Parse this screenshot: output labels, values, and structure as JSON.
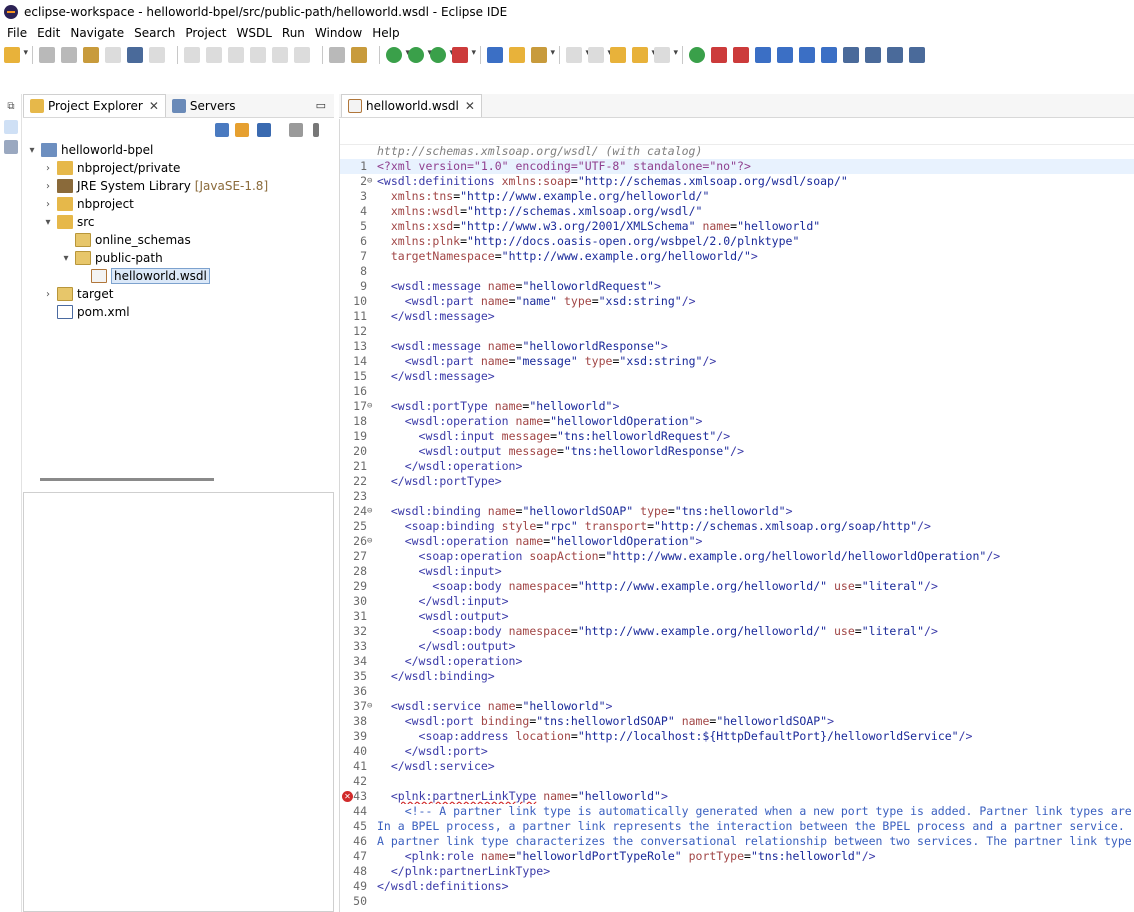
{
  "window": {
    "title": "eclipse-workspace - helloworld-bpel/src/public-path/helloworld.wsdl - Eclipse IDE"
  },
  "menu": [
    "File",
    "Edit",
    "Navigate",
    "Search",
    "Project",
    "WSDL",
    "Run",
    "Window",
    "Help"
  ],
  "explorer": {
    "tabs": [
      {
        "label": "Project Explorer",
        "active": true
      },
      {
        "label": "Servers",
        "active": false
      }
    ],
    "tree": [
      {
        "label": "helloworld-bpel",
        "depth": 0,
        "expanded": true,
        "icon": "project-icon"
      },
      {
        "label": "nbproject/private",
        "depth": 1,
        "expanded": false,
        "icon": "package-folder-icon"
      },
      {
        "label": "JRE System Library",
        "decoration": "[JavaSE-1.8]",
        "depth": 1,
        "expanded": false,
        "icon": "library-icon"
      },
      {
        "label": "nbproject",
        "depth": 1,
        "expanded": false,
        "icon": "package-folder-icon"
      },
      {
        "label": "src",
        "depth": 1,
        "expanded": true,
        "icon": "package-folder-icon"
      },
      {
        "label": "online_schemas",
        "depth": 2,
        "expanded": null,
        "icon": "folder-icon"
      },
      {
        "label": "public-path",
        "depth": 2,
        "expanded": true,
        "icon": "folder-icon"
      },
      {
        "label": "helloworld.wsdl",
        "depth": 3,
        "expanded": null,
        "icon": "wsdl-file-icon",
        "selected": true
      },
      {
        "label": "target",
        "depth": 1,
        "expanded": false,
        "icon": "folder-icon"
      },
      {
        "label": "pom.xml",
        "depth": 1,
        "expanded": null,
        "icon": "maven-file-icon"
      }
    ]
  },
  "editor": {
    "tab": "helloworld.wsdl",
    "schema_hint": "http://schemas.xmlsoap.org/wsdl/ (with catalog)",
    "lines": [
      {
        "n": "1",
        "text": "<?xml version=\"1.0\" encoding=\"UTF-8\" standalone=\"no\"?>"
      },
      {
        "n": "2",
        "text": "<wsdl:definitions xmlns:soap=\"http://schemas.xmlsoap.org/wsdl/soap/\""
      },
      {
        "n": "3",
        "text": "  xmlns:tns=\"http://www.example.org/helloworld/\""
      },
      {
        "n": "4",
        "text": "  xmlns:wsdl=\"http://schemas.xmlsoap.org/wsdl/\""
      },
      {
        "n": "5",
        "text": "  xmlns:xsd=\"http://www.w3.org/2001/XMLSchema\" name=\"helloworld\""
      },
      {
        "n": "6",
        "text": "  xmlns:plnk=\"http://docs.oasis-open.org/wsbpel/2.0/plnktype\""
      },
      {
        "n": "7",
        "text": "  targetNamespace=\"http://www.example.org/helloworld/\">"
      },
      {
        "n": "8",
        "text": ""
      },
      {
        "n": "9",
        "text": "  <wsdl:message name=\"helloworldRequest\">"
      },
      {
        "n": "10",
        "text": "    <wsdl:part name=\"name\" type=\"xsd:string\"/>"
      },
      {
        "n": "11",
        "text": "  </wsdl:message>"
      },
      {
        "n": "12",
        "text": ""
      },
      {
        "n": "13",
        "text": "  <wsdl:message name=\"helloworldResponse\">"
      },
      {
        "n": "14",
        "text": "    <wsdl:part name=\"message\" type=\"xsd:string\"/>"
      },
      {
        "n": "15",
        "text": "  </wsdl:message>"
      },
      {
        "n": "16",
        "text": ""
      },
      {
        "n": "17",
        "text": "  <wsdl:portType name=\"helloworld\">"
      },
      {
        "n": "18",
        "text": "    <wsdl:operation name=\"helloworldOperation\">"
      },
      {
        "n": "19",
        "text": "      <wsdl:input message=\"tns:helloworldRequest\"/>"
      },
      {
        "n": "20",
        "text": "      <wsdl:output message=\"tns:helloworldResponse\"/>"
      },
      {
        "n": "21",
        "text": "    </wsdl:operation>"
      },
      {
        "n": "22",
        "text": "  </wsdl:portType>"
      },
      {
        "n": "23",
        "text": ""
      },
      {
        "n": "24",
        "text": "  <wsdl:binding name=\"helloworldSOAP\" type=\"tns:helloworld\">"
      },
      {
        "n": "25",
        "text": "    <soap:binding style=\"rpc\" transport=\"http://schemas.xmlsoap.org/soap/http\"/>"
      },
      {
        "n": "26",
        "text": "    <wsdl:operation name=\"helloworldOperation\">"
      },
      {
        "n": "27",
        "text": "      <soap:operation soapAction=\"http://www.example.org/helloworld/helloworldOperation\"/>"
      },
      {
        "n": "28",
        "text": "      <wsdl:input>"
      },
      {
        "n": "29",
        "text": "        <soap:body namespace=\"http://www.example.org/helloworld/\" use=\"literal\"/>"
      },
      {
        "n": "30",
        "text": "      </wsdl:input>"
      },
      {
        "n": "31",
        "text": "      <wsdl:output>"
      },
      {
        "n": "32",
        "text": "        <soap:body namespace=\"http://www.example.org/helloworld/\" use=\"literal\"/>"
      },
      {
        "n": "33",
        "text": "      </wsdl:output>"
      },
      {
        "n": "34",
        "text": "    </wsdl:operation>"
      },
      {
        "n": "35",
        "text": "  </wsdl:binding>"
      },
      {
        "n": "36",
        "text": ""
      },
      {
        "n": "37",
        "text": "  <wsdl:service name=\"helloworld\">"
      },
      {
        "n": "38",
        "text": "    <wsdl:port binding=\"tns:helloworldSOAP\" name=\"helloworldSOAP\">"
      },
      {
        "n": "39",
        "text": "      <soap:address location=\"http://localhost:${HttpDefaultPort}/helloworldService\"/>"
      },
      {
        "n": "40",
        "text": "    </wsdl:port>"
      },
      {
        "n": "41",
        "text": "  </wsdl:service>"
      },
      {
        "n": "42",
        "text": ""
      },
      {
        "n": "43",
        "text": "  <plnk:partnerLinkType name=\"helloworld\">"
      },
      {
        "n": "44",
        "text": "    <!-- A partner link type is automatically generated when a new port type is added. Partner link types are"
      },
      {
        "n": "45",
        "text": "In a BPEL process, a partner link represents the interaction between the BPEL process and a partner service."
      },
      {
        "n": "46",
        "text": "A partner link type characterizes the conversational relationship between two services. The partner link type"
      },
      {
        "n": "47",
        "text": "    <plnk:role name=\"helloworldPortTypeRole\" portType=\"tns:helloworld\"/>"
      },
      {
        "n": "48",
        "text": "  </plnk:partnerLinkType>"
      },
      {
        "n": "49",
        "text": "</wsdl:definitions>"
      },
      {
        "n": "50",
        "text": ""
      }
    ]
  }
}
